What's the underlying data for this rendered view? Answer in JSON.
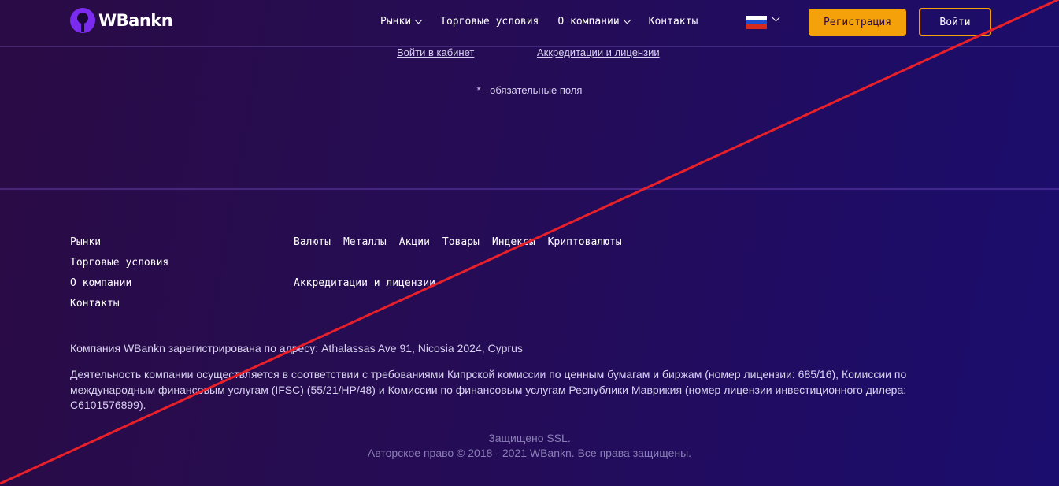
{
  "header": {
    "logo_text": "WBankn",
    "nav": [
      {
        "label": "Рынки",
        "has_dropdown": true
      },
      {
        "label": "Торговые условия",
        "has_dropdown": false
      },
      {
        "label": "О компании",
        "has_dropdown": true
      },
      {
        "label": "Контакты",
        "has_dropdown": false
      }
    ],
    "language_icon": "russia-flag-icon",
    "register_label": "Регистрация",
    "login_label": "Войти"
  },
  "form_links": {
    "cabinet": "Войти в кабинет",
    "accreditation": "Аккредитации и лицензии"
  },
  "required_note": "* - обязательные поля",
  "footer": {
    "nav": [
      "Рынки",
      "Торговые условия",
      "О компании",
      "Контакты"
    ],
    "markets": [
      "Валюты",
      "Металлы",
      "Акции",
      "Товары",
      "Индексы",
      "Криптовалюты"
    ],
    "accreditation": "Аккредитации и лицензии",
    "address": "Компания WBankn зарегистрирована по адресу: Athalassas Ave 91, Nicosia 2024, Cyprus",
    "license": "Деятельность компании осуществляется в соответствии с требованиями Кипрской комиссии по ценным бумагам и биржам (номер лицензии: 685/16), Комиссии по международным финансовым услугам (IFSC) (55/21/HP/48) и Комиссии по финансовым услугам Республики Маврикия (номер лицензии инвестиционного дилера: C6101576899).",
    "ssl": "Защищено SSL.",
    "copyright": "Авторское право © 2018 - 2021 WBankn. Все права защищены."
  },
  "colors": {
    "accent": "#f5a10a",
    "overlay_line": "#e8202a",
    "background_start": "#2a0b45",
    "background_end": "#1b0d6e"
  }
}
